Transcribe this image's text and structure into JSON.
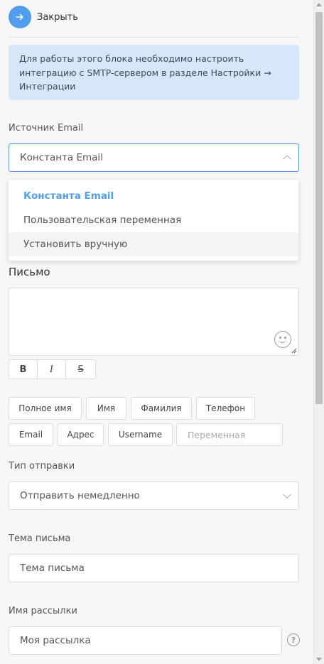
{
  "close": {
    "label": "Закрыть",
    "icon": "arrow-right-icon"
  },
  "info": {
    "text": "Для работы этого блока необходимо настроить интеграцию с SMTP-сервером в разделе Настройки → Интеграции"
  },
  "email_source": {
    "label": "Источник Email",
    "value": "Константа Email",
    "options": [
      "Константа Email",
      "Пользовательская переменная",
      "Установить вручную"
    ]
  },
  "message": {
    "heading": "Письмо"
  },
  "format": {
    "bold": "B",
    "italic": "I",
    "strike": "S"
  },
  "variables": {
    "full_name": "Полное имя",
    "first_name": "Имя",
    "last_name": "Фамилия",
    "phone": "Телефон",
    "email": "Email",
    "address": "Адрес",
    "username": "Username",
    "variable_placeholder": "Переменная"
  },
  "send_type": {
    "label": "Тип отправки",
    "value": "Отправить немедленно"
  },
  "subject": {
    "label": "Тема письма",
    "placeholder": "Тема письма"
  },
  "mailing_name": {
    "label": "Имя рассылки",
    "value": "Моя рассылка",
    "help": "?"
  },
  "colors": {
    "accent": "#4f9ef0",
    "info_bg": "#d7e7fb"
  }
}
